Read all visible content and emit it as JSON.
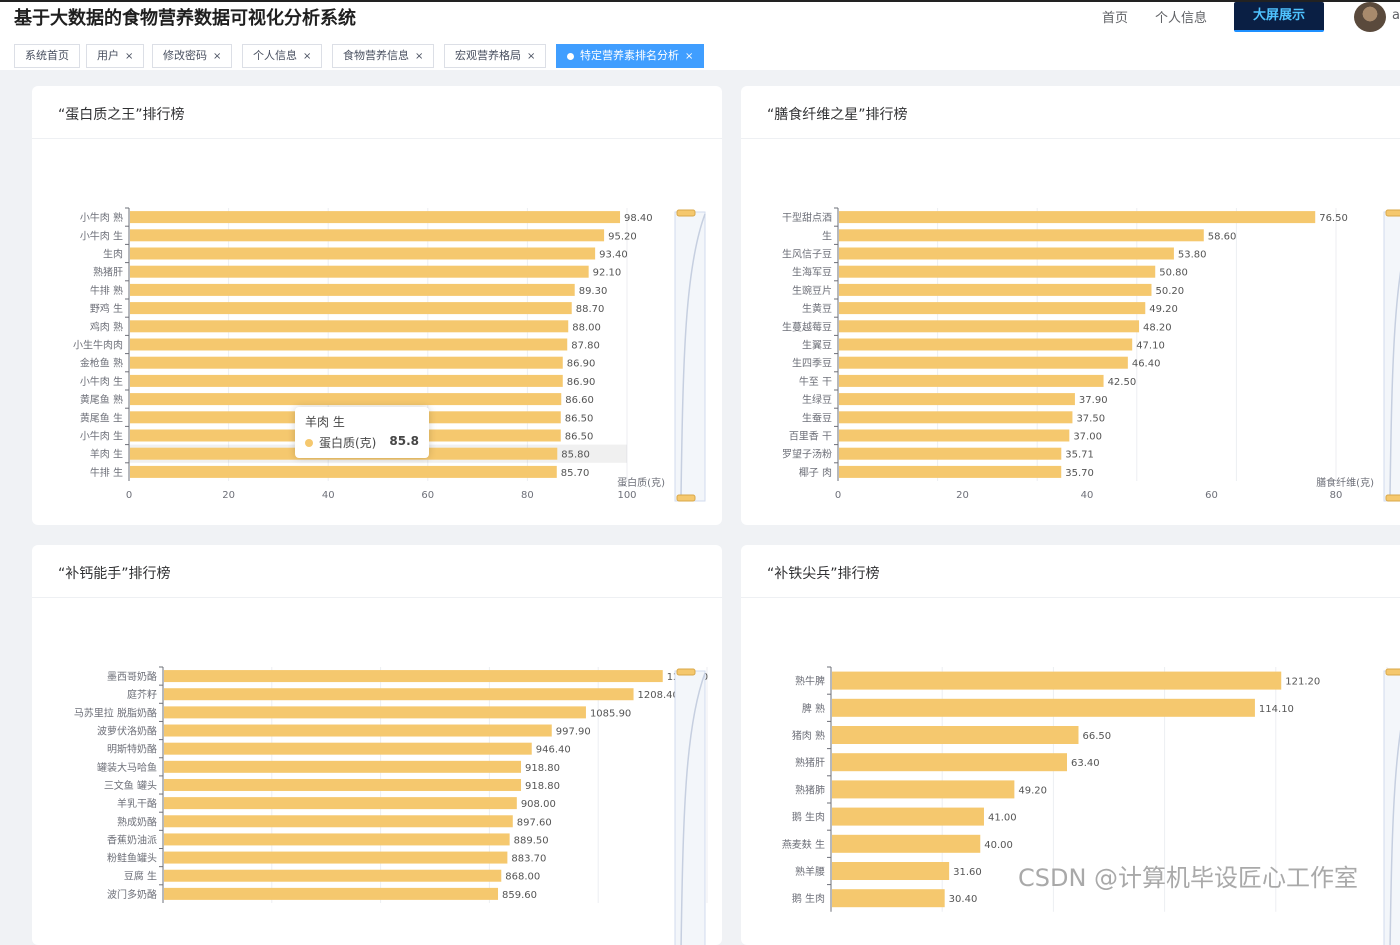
{
  "header": {
    "title": "基于大数据的食物营养数据可视化分析系统",
    "nav": [
      "首页",
      "个人信息"
    ],
    "big_screen": "大屏展示",
    "user_initial": "a"
  },
  "tabs": [
    {
      "label": "系统首页",
      "closable": false,
      "active": false
    },
    {
      "label": "用户",
      "closable": true,
      "active": false
    },
    {
      "label": "修改密码",
      "closable": true,
      "active": false
    },
    {
      "label": "个人信息",
      "closable": true,
      "active": false
    },
    {
      "label": "食物营养信息",
      "closable": true,
      "active": false
    },
    {
      "label": "宏观营养格局",
      "closable": true,
      "active": false
    },
    {
      "label": "特定营养素排名分析",
      "closable": true,
      "active": true
    }
  ],
  "tab_close_glyph": "×",
  "tooltip": {
    "name": "羊肉 生",
    "series": "蛋白质(克)",
    "value": "85.8",
    "color": "#f5c86e"
  },
  "watermark": "CSDN @计算机毕设匠心工作室",
  "bar_color": "#f5c86e",
  "chart_data": [
    {
      "type": "bar",
      "orientation": "horizontal",
      "title": "“蛋白质之王”排行榜",
      "xlabel": "蛋白质(克)",
      "xlim": [
        0,
        100
      ],
      "xticks": [
        0,
        20,
        40,
        60,
        80,
        100
      ],
      "categories": [
        "小牛肉 熟",
        "小牛肉 生",
        "生肉",
        "熟猪肝",
        "牛排 熟",
        "野鸡 生",
        "鸡肉 熟",
        "小生牛肉肉",
        "金枪鱼 熟",
        "小牛肉 生",
        "黄尾鱼 熟",
        "黄尾鱼 生",
        "小牛肉 生",
        "羊肉 生",
        "牛排 生"
      ],
      "values": [
        98.4,
        95.2,
        93.4,
        92.1,
        89.3,
        88.7,
        88.0,
        87.8,
        86.9,
        86.9,
        86.6,
        86.5,
        86.5,
        85.8,
        85.7
      ],
      "labels": [
        "98.40",
        "95.20",
        "93.40",
        "92.10",
        "89.30",
        "88.70",
        "88.00",
        "87.80",
        "86.90",
        "86.90",
        "86.60",
        "86.50",
        "86.50",
        "85.80",
        "85.70"
      ],
      "highlight_index": 13,
      "grid": true,
      "datazoom": true
    },
    {
      "type": "bar",
      "orientation": "horizontal",
      "title": "“膳食纤维之星”排行榜",
      "xlabel": "膳食纤维(克)",
      "xlim": [
        0,
        80
      ],
      "xticks": [
        0,
        20,
        40,
        60,
        80
      ],
      "categories": [
        "干型甜点酒",
        "生",
        "生风信子豆",
        "生海军豆",
        "生豌豆片",
        "生黄豆",
        "生蔓越莓豆",
        "生翼豆",
        "生四季豆",
        "牛至 干",
        "生绿豆",
        "生蚕豆",
        "百里香 干",
        "罗望子汤粉",
        "椰子 肉"
      ],
      "values": [
        76.5,
        58.6,
        53.8,
        50.8,
        50.2,
        49.2,
        48.2,
        47.1,
        46.4,
        42.5,
        37.9,
        37.5,
        37.0,
        35.71,
        35.7
      ],
      "labels": [
        "76.50",
        "58.60",
        "53.80",
        "50.80",
        "50.20",
        "49.20",
        "48.20",
        "47.10",
        "46.40",
        "42.50",
        "37.90",
        "37.50",
        "37.00",
        "35.71",
        "35.70"
      ],
      "grid": true,
      "datazoom": true
    },
    {
      "type": "bar",
      "orientation": "horizontal",
      "title": "“补钙能手”排行榜",
      "xlabel": "",
      "xlim": [
        0,
        1400
      ],
      "categories": [
        "墨西哥奶酪",
        "庭芥籽",
        "马苏里拉 脱脂奶酪",
        "波萝伏洛奶酪",
        "明斯特奶酪",
        "罐装大马哈鱼",
        "三文鱼 罐头",
        "羊乳干酪",
        "熟成奶酪",
        "香蕉奶油派",
        "粉鲑鱼罐头",
        "豆腐 生",
        "波门多奶酪"
      ],
      "values": [
        1283.5,
        1208.4,
        1085.9,
        997.9,
        946.4,
        918.8,
        918.8,
        908.0,
        897.6,
        889.5,
        883.7,
        868.0,
        859.6
      ],
      "labels": [
        "1283.50",
        "1208.40",
        "1085.90",
        "997.90",
        "946.40",
        "918.80",
        "918.80",
        "908.00",
        "897.60",
        "889.50",
        "883.70",
        "868.00",
        "859.60"
      ],
      "grid": true,
      "datazoom": true
    },
    {
      "type": "bar",
      "orientation": "horizontal",
      "title": "“补铁尖兵”排行榜",
      "xlabel": "",
      "xlim": [
        0,
        150
      ],
      "categories": [
        "熟牛脾",
        "脾 熟",
        "猪肉 熟",
        "熟猪肝",
        "熟猪肺",
        "鹅 生肉",
        "燕麦麸 生",
        "熟羊腰",
        "鹅 生肉"
      ],
      "values": [
        121.2,
        114.1,
        66.5,
        63.4,
        49.2,
        41.0,
        40.0,
        31.6,
        30.4
      ],
      "labels": [
        "121.20",
        "114.10",
        "66.50",
        "63.40",
        "49.20",
        "41.00",
        "40.00",
        "31.60",
        "30.40"
      ],
      "grid": true,
      "datazoom": true
    }
  ]
}
